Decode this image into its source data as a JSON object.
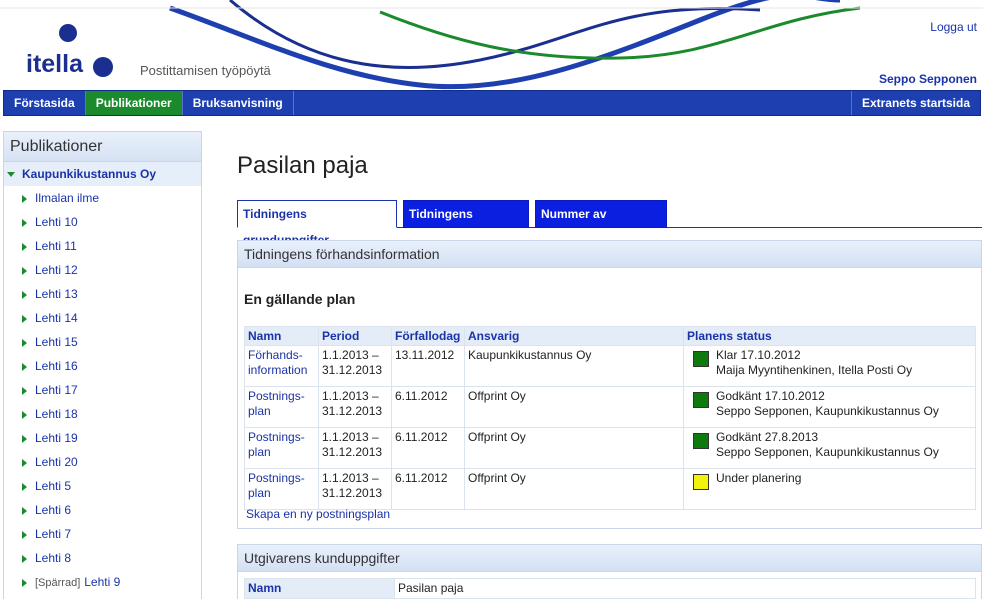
{
  "header": {
    "logo_text": "itella",
    "tagline": "Postittamisen työpöytä",
    "logout_label": "Logga ut",
    "username": "Seppo Sepponen"
  },
  "nav": {
    "items": [
      {
        "label": "Förstasida",
        "active": false
      },
      {
        "label": "Publikationer",
        "active": true
      },
      {
        "label": "Bruksanvisning",
        "active": false
      }
    ],
    "right_label": "Extranets startsida"
  },
  "sidebar": {
    "title": "Publikationer",
    "top_item": "Kaupunkikustannus Oy",
    "items": [
      {
        "label": "Ilmalan ilme"
      },
      {
        "label": "Lehti 10"
      },
      {
        "label": "Lehti 11"
      },
      {
        "label": "Lehti 12"
      },
      {
        "label": "Lehti 13"
      },
      {
        "label": "Lehti 14"
      },
      {
        "label": "Lehti 15"
      },
      {
        "label": "Lehti 16"
      },
      {
        "label": "Lehti 17"
      },
      {
        "label": "Lehti 18"
      },
      {
        "label": "Lehti 19"
      },
      {
        "label": "Lehti 20"
      },
      {
        "label": "Lehti 5"
      },
      {
        "label": "Lehti 6"
      },
      {
        "label": "Lehti 7"
      },
      {
        "label": "Lehti 8"
      },
      {
        "label": "Lehti 9",
        "prefix": "[Spärrad]"
      }
    ]
  },
  "main": {
    "title": "Pasilan paja",
    "tabs": [
      {
        "label": "Tidningens grunduppgifter",
        "active": true
      },
      {
        "label": "Tidningens kalender",
        "active": false
      },
      {
        "label": "Nummer av tidningen",
        "active": false
      }
    ],
    "plan_panel": {
      "heading": "Tidningens förhandsinformation",
      "subheading": "En gällande plan",
      "columns": [
        "Namn",
        "Period",
        "Förfallodag",
        "Ansvarig",
        "Planens status"
      ],
      "rows": [
        {
          "name": "Förhands-information",
          "name_l1": "Förhands-",
          "name_l2": "information",
          "period_l1": "1.1.2013 –",
          "period_l2": "31.12.2013",
          "due": "13.11.2012",
          "responsible": "Kaupunkikustannus Oy",
          "status_l1": "Klar 17.10.2012",
          "status_l2": "Maija Myyntihenkinen, Itella Posti Oy",
          "status_color": "#0c7a0c"
        },
        {
          "name": "Postnings-plan",
          "name_l1": "Postnings-",
          "name_l2": "plan",
          "period_l1": "1.1.2013 –",
          "period_l2": "31.12.2013",
          "due": "6.11.2012",
          "responsible": "Offprint Oy",
          "status_l1": "Godkänt 17.10.2012",
          "status_l2": "Seppo Sepponen, Kaupunkikustannus Oy",
          "status_color": "#0c7a0c"
        },
        {
          "name": "Postnings-plan",
          "name_l1": "Postnings-",
          "name_l2": "plan",
          "period_l1": "1.1.2013 –",
          "period_l2": "31.12.2013",
          "due": "6.11.2012",
          "responsible": "Offprint Oy",
          "status_l1": "Godkänt 27.8.2013",
          "status_l2": "Seppo Sepponen, Kaupunkikustannus Oy",
          "status_color": "#0c7a0c"
        },
        {
          "name": "Postnings-plan",
          "name_l1": "Postnings-",
          "name_l2": "plan",
          "period_l1": "1.1.2013 –",
          "period_l2": "31.12.2013",
          "due": "6.11.2012",
          "responsible": "Offprint Oy",
          "status_l1": "Under planering",
          "status_l2": "",
          "status_color": "#f2f20a"
        }
      ],
      "create_link": "Skapa en ny postningsplan"
    },
    "publisher_panel": {
      "heading": "Utgivarens kunduppgifter",
      "name_label": "Namn",
      "name_value": "Pasilan paja"
    }
  },
  "colors": {
    "brand_blue": "#1a2f8f",
    "nav_blue": "#1e3fb0",
    "active_green": "#1b8a2d",
    "status_ok": "#0c7a0c",
    "status_pending": "#f2f20a"
  }
}
